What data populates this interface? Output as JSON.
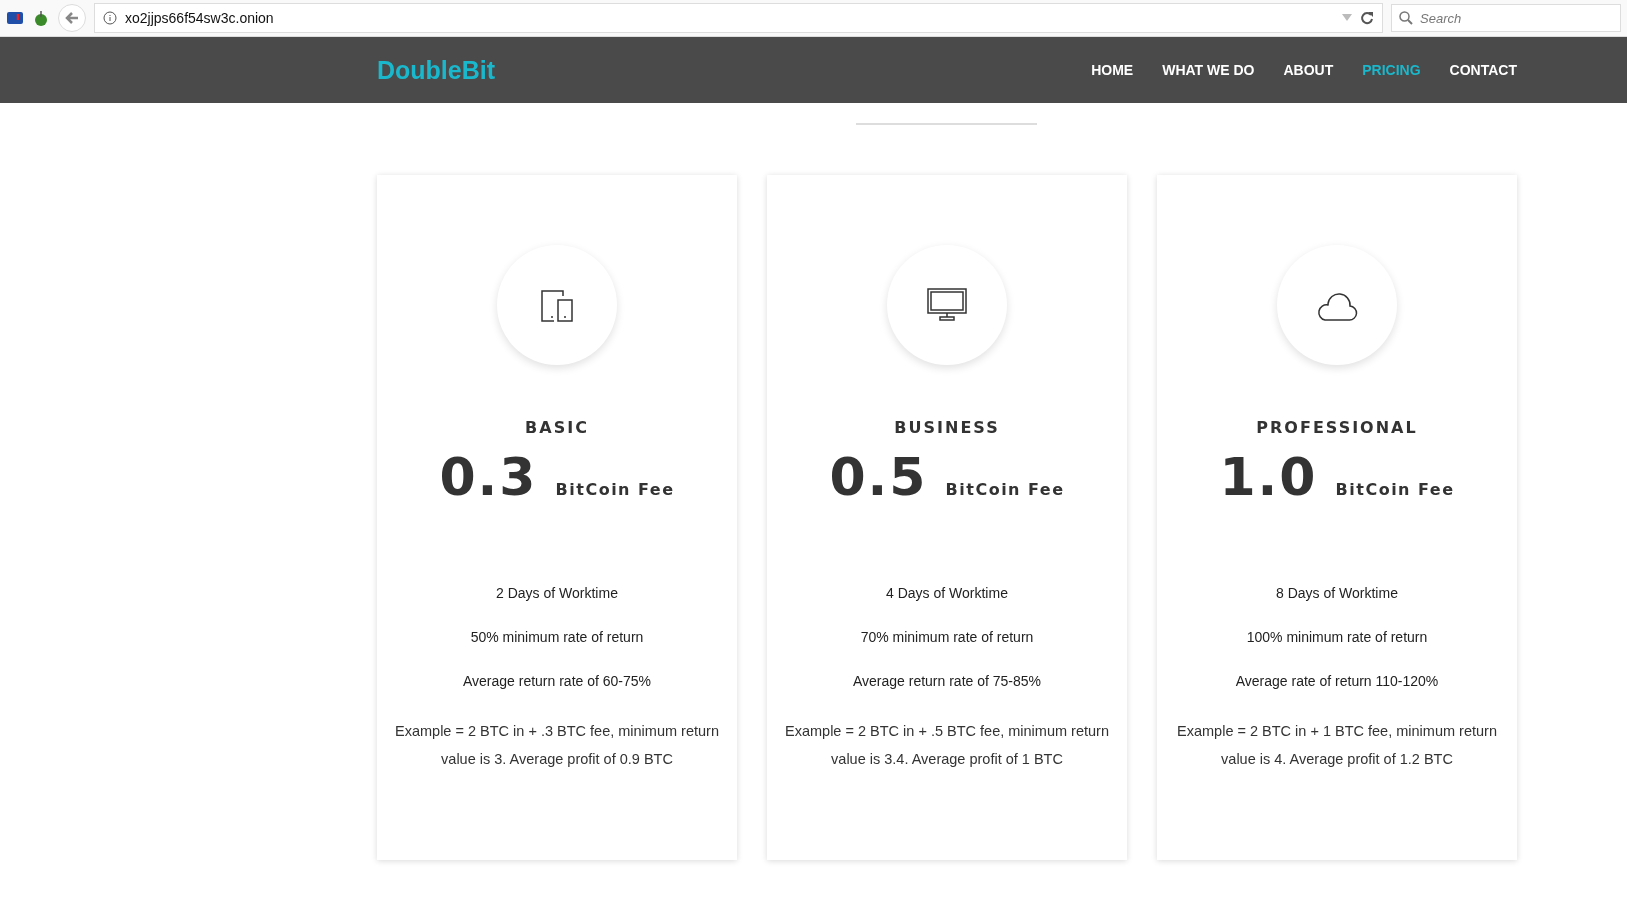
{
  "browser": {
    "url": "xo2jjps66f54sw3c.onion",
    "search": {
      "placeholder": "Search"
    }
  },
  "navbar": {
    "logo": "DoubleBit",
    "links": [
      {
        "label": "HOME",
        "selected": false
      },
      {
        "label": "WHAT WE DO",
        "selected": false
      },
      {
        "label": "ABOUT",
        "selected": false
      },
      {
        "label": "PRICING",
        "selected": true
      },
      {
        "label": "CONTACT",
        "selected": false
      }
    ]
  },
  "plans": [
    {
      "kind": "devices",
      "name": "BASIC",
      "price": "0.3",
      "unit": "BitCoin Fee",
      "features": [
        "2 Days of Worktime",
        "50% minimum rate of return",
        "Average return rate of 60-75%"
      ],
      "example": "Example = 2 BTC in + .3 BTC fee, minimum return value is 3. Average profit of 0.9 BTC"
    },
    {
      "kind": "monitor",
      "name": "BUSINESS",
      "price": "0.5",
      "unit": "BitCoin Fee",
      "features": [
        "4 Days of Worktime",
        "70% minimum rate of return",
        "Average return rate of 75-85%"
      ],
      "example": "Example = 2 BTC in + .5 BTC fee, minimum return value is 3.4. Average profit of 1 BTC"
    },
    {
      "kind": "cloud",
      "name": "PROFESSIONAL",
      "price": "1.0",
      "unit": "BitCoin Fee",
      "features": [
        "8 Days of Worktime",
        "100% minimum rate of return",
        "Average rate of return 110-120%"
      ],
      "example": "Example = 2 BTC in + 1 BTC fee, minimum return value is 4. Average profit of 1.2 BTC"
    }
  ]
}
